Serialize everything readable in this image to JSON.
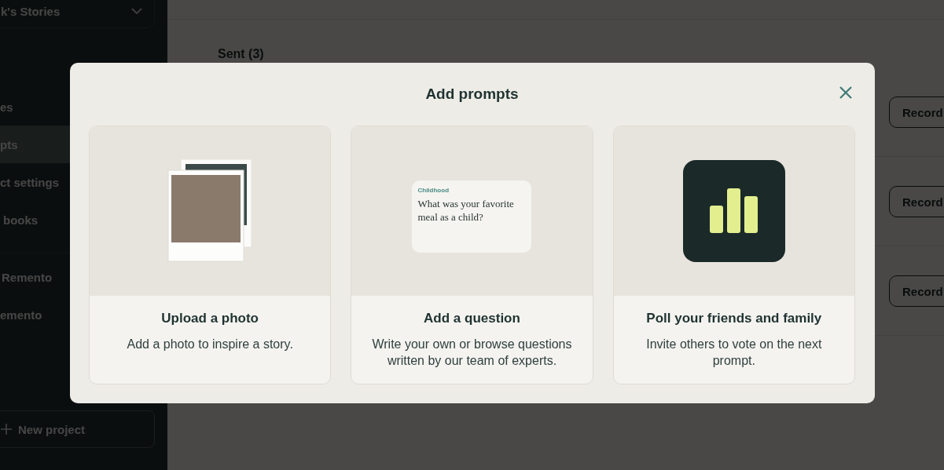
{
  "sidebar": {
    "project_title": "k's Stories",
    "items": [
      {
        "label": "es",
        "selected": false
      },
      {
        "label": "pts",
        "selected": true
      },
      {
        "label": "ct settings",
        "selected": false
      },
      {
        "label": "books",
        "selected": false
      }
    ],
    "links": [
      "Remento",
      "emento"
    ],
    "new_project_button": "New project"
  },
  "main": {
    "section_title": "Sent (3)",
    "rows": [
      {
        "button": "Record"
      },
      {
        "button": "Record"
      },
      {
        "button": "Record"
      }
    ]
  },
  "modal": {
    "title": "Add prompts",
    "cards": [
      {
        "kind": "photo",
        "title": "Upload a photo",
        "description": "Add a photo to inspire a story."
      },
      {
        "kind": "question",
        "title": "Add a question",
        "description": "Write your own or browse questions written by our team of experts.",
        "category": "Childhood",
        "question": "What was your favorite meal as a child?"
      },
      {
        "kind": "poll",
        "title": "Poll your friends and family",
        "description": "Invite others to vote on the next prompt."
      }
    ]
  }
}
